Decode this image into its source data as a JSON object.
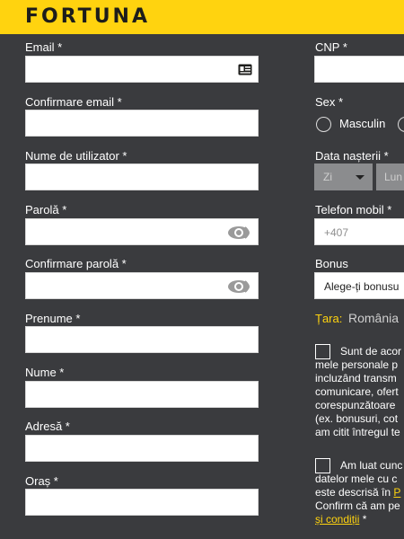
{
  "brand": {
    "logo_text": "FORTUNA",
    "accent": "#ffd30f",
    "background": "#3a3b3e"
  },
  "left_form": {
    "email": {
      "label": "Email *",
      "value": "",
      "icon": "contact-card-icon"
    },
    "confirm_email": {
      "label": "Confirmare email *",
      "value": ""
    },
    "username": {
      "label": "Nume de utilizator *",
      "value": ""
    },
    "password": {
      "label": "Parolă *",
      "value": "",
      "icon": "eye-icon"
    },
    "confirm_password": {
      "label": "Confirmare parolă *",
      "value": "",
      "icon": "eye-icon"
    },
    "first_name": {
      "label": "Prenume *",
      "value": ""
    },
    "last_name": {
      "label": "Nume *",
      "value": ""
    },
    "address": {
      "label": "Adresă *",
      "value": ""
    },
    "city": {
      "label": "Oraș *",
      "value": ""
    }
  },
  "right_form": {
    "cnp": {
      "label": "CNP *",
      "value": ""
    },
    "sex": {
      "label": "Sex *",
      "options": [
        "Masculin",
        ""
      ]
    },
    "birth_date": {
      "label": "Data nașterii *",
      "day_placeholder": "Zi",
      "month_placeholder": "Lun"
    },
    "phone": {
      "label": "Telefon mobil *",
      "value": "+407"
    },
    "bonus": {
      "label": "Bonus",
      "value": "Alege-ți bonusu"
    },
    "country": {
      "label": "Țara:",
      "value": "România"
    },
    "consent_marketing": {
      "lines": [
        "Sunt de acor",
        "mele personale p",
        "incluzând transm",
        "comunicare, ofert",
        "corespunzătoare",
        "(ex. bonusuri, cot",
        "am citit întregul te"
      ],
      "checked": false
    },
    "consent_terms": {
      "lines": [
        "Am luat cunc",
        "datelor mele cu c",
        "este descrisă în ",
        "Confirm că am pe"
      ],
      "link_fragment": "P",
      "link_last": "și condiții",
      "last_suffix": " *",
      "checked": false
    }
  }
}
